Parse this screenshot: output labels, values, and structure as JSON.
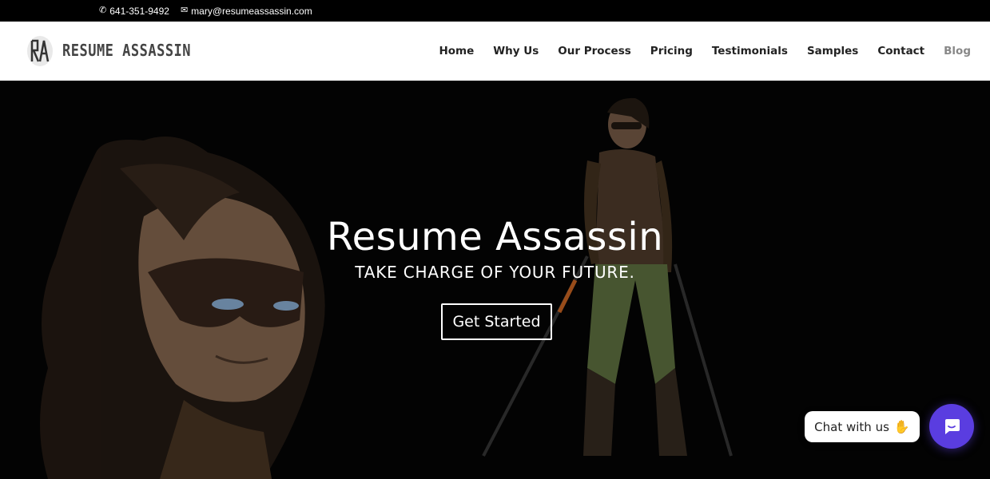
{
  "topbar": {
    "phone_icon": "phone-icon",
    "phone": "641-351-9492",
    "email_icon": "envelope-icon",
    "email": "mary@resumeassassin.com"
  },
  "header": {
    "logo_text": "RESUME ASSASSIN",
    "nav": [
      {
        "label": "Home"
      },
      {
        "label": "Why Us"
      },
      {
        "label": "Our Process"
      },
      {
        "label": "Pricing"
      },
      {
        "label": "Testimonials"
      },
      {
        "label": "Samples"
      },
      {
        "label": "Contact"
      },
      {
        "label": "Blog"
      }
    ]
  },
  "hero": {
    "title": "Resume Assassin",
    "subtitle": "TAKE CHARGE OF YOUR FUTURE.",
    "cta_label": "Get Started"
  },
  "chat": {
    "label": "Chat with us",
    "wave_icon": "waving-hand-icon",
    "button_icon": "chat-icon",
    "accent": "#5a3de0"
  }
}
